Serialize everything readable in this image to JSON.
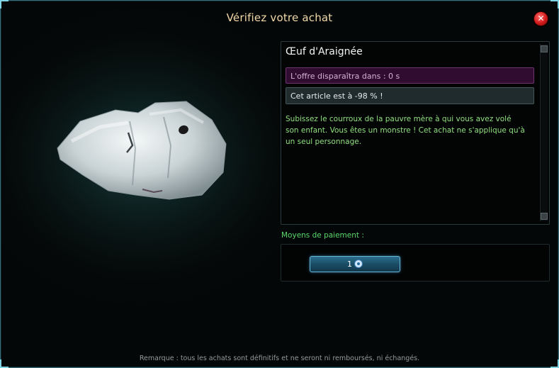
{
  "dialog": {
    "title": "Vérifiez votre achat",
    "close_icon": "close-icon",
    "accent_color": "#7fd4e6"
  },
  "item": {
    "name": "Œuf d'Araignée",
    "offer_text": "L'offre disparaîtra dans : 0 s",
    "discount_text": "Cet article est à -98 % !",
    "description": "Subissez le courroux de la pauvre mère à qui vous avez volé son enfant. Vous êtes un monstre ! Cet achat ne s'applique qu'à un seul personnage.",
    "image": "spider-egg-image"
  },
  "payment": {
    "label": "Moyens de paiement :",
    "price_value": "1",
    "currency_icon": "currency-coin-icon"
  },
  "footer": {
    "remark": "Remarque : tous les achats sont définitifs et ne seront ni remboursés, ni échangés."
  }
}
